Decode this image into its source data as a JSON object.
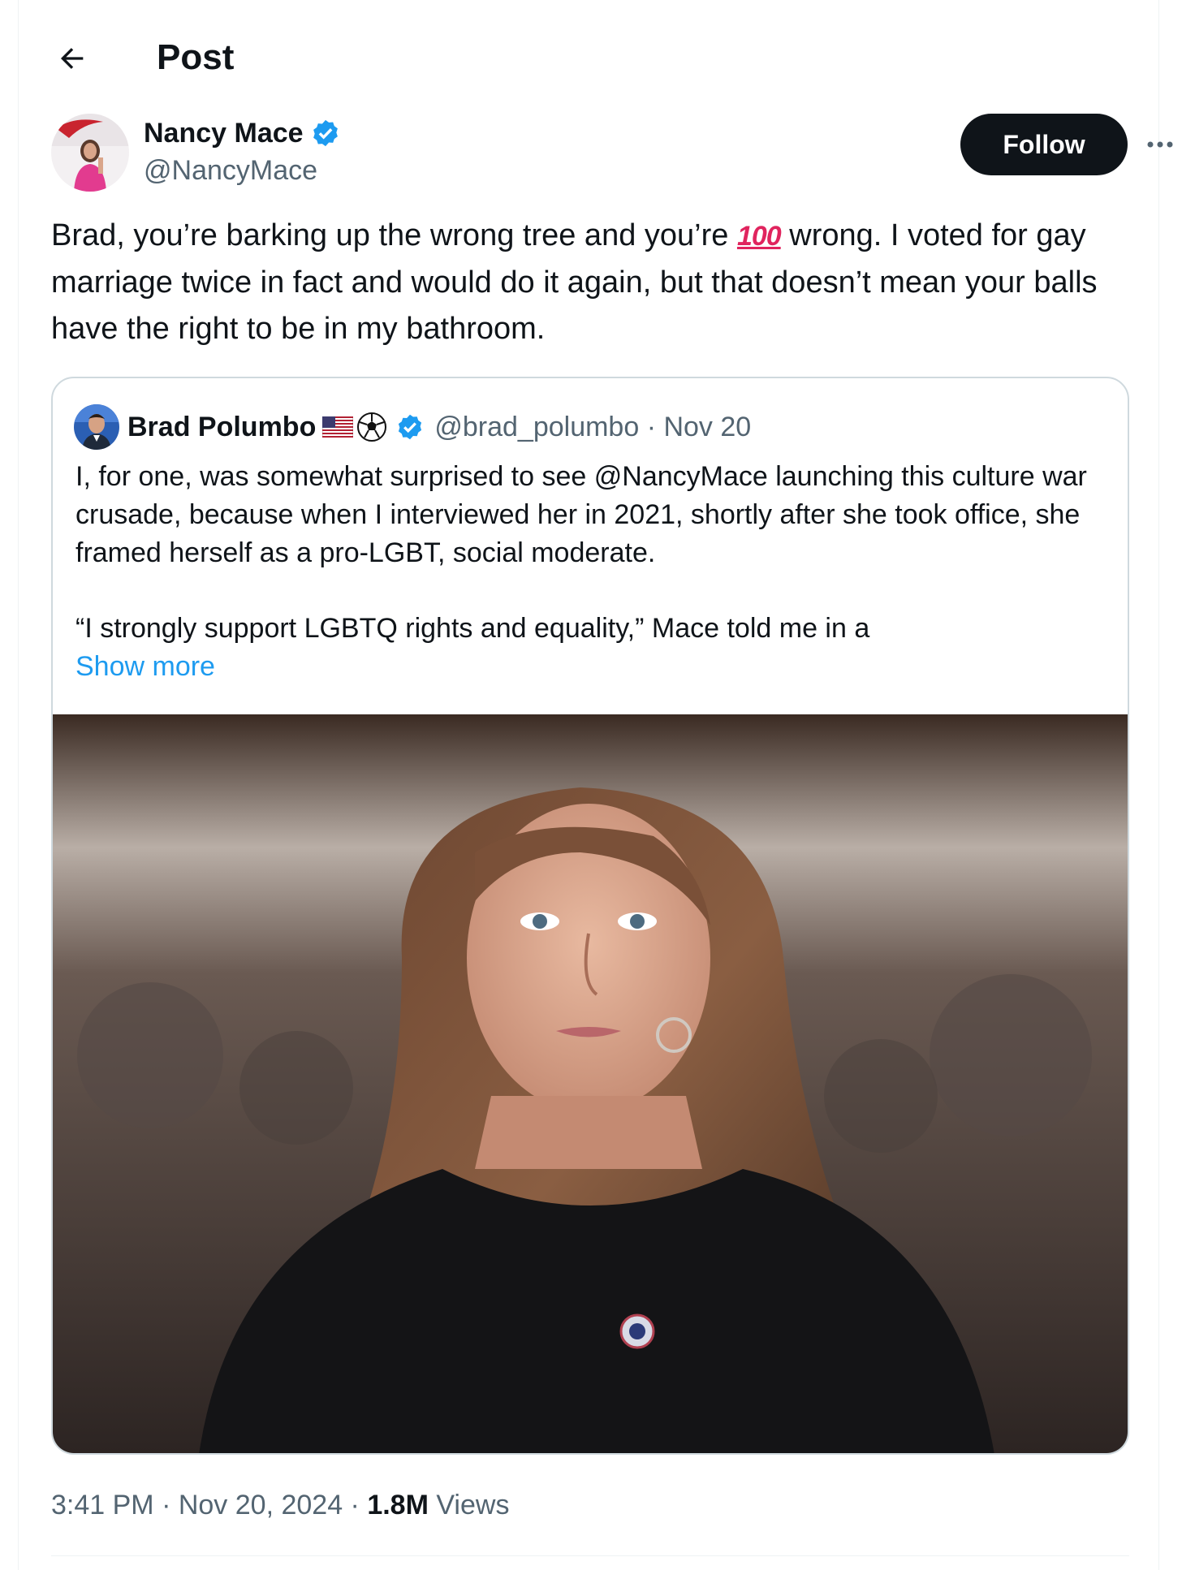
{
  "header": {
    "title": "Post",
    "back_icon": "arrow-left-icon"
  },
  "author": {
    "name": "Nancy Mace",
    "handle": "@NancyMace",
    "verified": true,
    "follow_label": "Follow",
    "more_icon": "more-horizontal-icon"
  },
  "post": {
    "text_before_emoji": "Brad, you’re barking up the wrong tree and you’re ",
    "emoji": "💯",
    "text_after_emoji": " wrong. I voted for gay marriage twice in fact and would do it again, but that doesn’t mean your balls have the right to be in my bathroom."
  },
  "quote": {
    "name": "Brad Polumbo",
    "name_emojis": [
      "🇺🇸",
      "⚽"
    ],
    "verified": true,
    "handle": "@brad_polumbo",
    "separator": " · ",
    "date": "Nov 20",
    "paragraph1": "I, for one, was somewhat surprised to see @NancyMace  launching this culture war crusade, because when I interviewed her in 2021, shortly after she took office, she framed herself as a pro-LGBT, social moderate.",
    "paragraph2": "“I strongly support LGBTQ rights and equality,” Mace told me in a",
    "show_more": "Show more"
  },
  "footer": {
    "time": "3:41 PM",
    "separator": " · ",
    "date": "Nov 20, 2024",
    "views_count": "1.8M",
    "views_label": " Views"
  },
  "colors": {
    "text": "#0f1419",
    "secondary": "#536471",
    "link": "#1d9bf0",
    "border": "#cfd9de",
    "follow_bg": "#0f1419"
  }
}
